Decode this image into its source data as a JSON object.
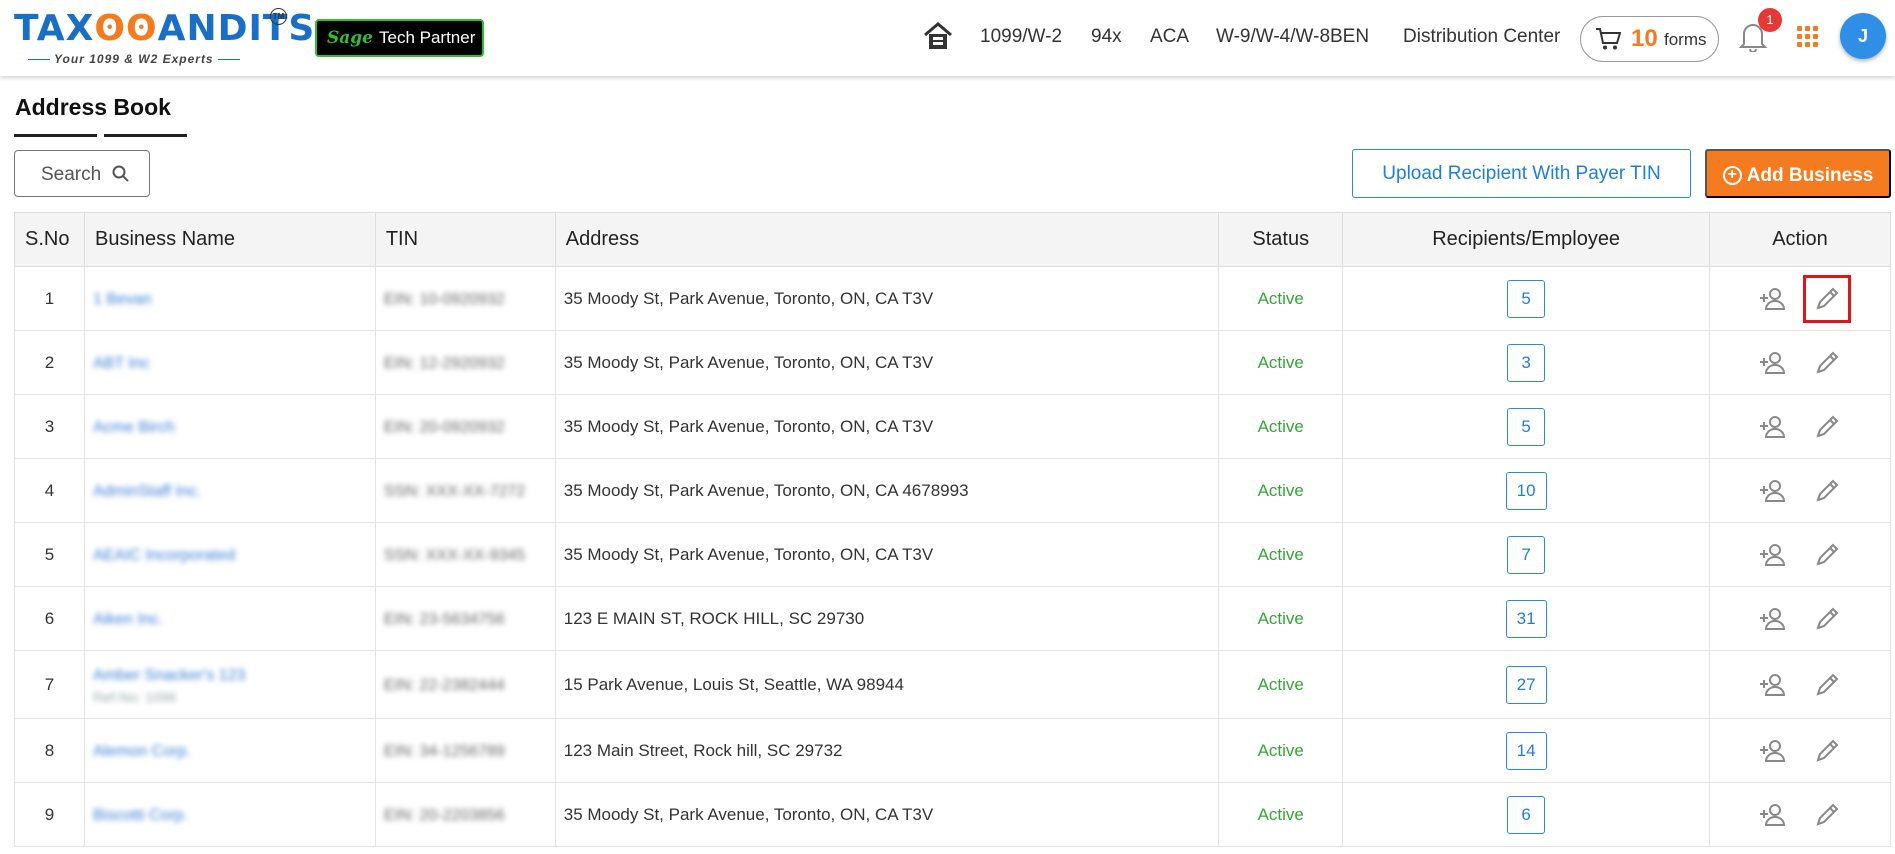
{
  "brand": {
    "name_part1": "TAX",
    "name_part2": "ANDITS",
    "tm": "TM",
    "tagline": "Your 1099 & W2 Experts",
    "partner_logo": "Sage",
    "partner_label": "Tech Partner"
  },
  "nav": {
    "home_icon": "home-icon",
    "items": [
      "1099/W-2",
      "94x",
      "ACA",
      "W-9/W-4/W-8BEN",
      "Distribution Center"
    ],
    "cart": {
      "count": "10",
      "label": "forms"
    },
    "notifications": "1",
    "avatar": "J"
  },
  "page": {
    "title": "Address Book"
  },
  "toolbar": {
    "search_label": "Search",
    "upload_label": "Upload Recipient With Payer TIN",
    "add_label": "Add Business",
    "add_symbol": "+"
  },
  "colors": {
    "accent": "#f47b20",
    "primary": "#1f7fd6",
    "active": "#35a635",
    "highlight": "#e0151b"
  },
  "table": {
    "headers": [
      "S.No",
      "Business Name",
      "TIN",
      "Address",
      "Status",
      "Recipients/Employee",
      "Action"
    ],
    "rows": [
      {
        "sno": "1",
        "name": "1 Bevan",
        "sub": "",
        "tin": "EIN: 10-0920932",
        "address": "35 Moody St, Park Avenue, Toronto, ON, CA T3V",
        "status": "Active",
        "count": "5"
      },
      {
        "sno": "2",
        "name": "ABT Inc",
        "sub": "",
        "tin": "EIN: 12-2920932",
        "address": "35 Moody St, Park Avenue, Toronto, ON, CA T3V",
        "status": "Active",
        "count": "3"
      },
      {
        "sno": "3",
        "name": "Acme Birch",
        "sub": "",
        "tin": "EIN: 20-0920932",
        "address": "35 Moody St, Park Avenue, Toronto, ON, CA T3V",
        "status": "Active",
        "count": "5"
      },
      {
        "sno": "4",
        "name": "AdminStaff Inc.",
        "sub": "",
        "tin": "SSN: XXX-XX-7272",
        "address": "35 Moody St, Park Avenue, Toronto, ON, CA 4678993",
        "status": "Active",
        "count": "10"
      },
      {
        "sno": "5",
        "name": "AEAIC Incorporated",
        "sub": "",
        "tin": "SSN: XXX-XX-9345",
        "address": "35 Moody St, Park Avenue, Toronto, ON, CA T3V",
        "status": "Active",
        "count": "7"
      },
      {
        "sno": "6",
        "name": "Aiken Inc.",
        "sub": "",
        "tin": "EIN: 23-5634756",
        "address": "123 E MAIN ST, ROCK HILL, SC 29730",
        "status": "Active",
        "count": "31"
      },
      {
        "sno": "7",
        "name": "Amber Snacker's 123",
        "sub": "Ref-No: 1096",
        "tin": "EIN: 22-2382444",
        "address": "15 Park Avenue, Louis St, Seattle, WA 98944",
        "status": "Active",
        "count": "27"
      },
      {
        "sno": "8",
        "name": "Alemon Corp.",
        "sub": "",
        "tin": "EIN: 34-1256789",
        "address": "123 Main Street, Rock hill, SC 29732",
        "status": "Active",
        "count": "14"
      },
      {
        "sno": "9",
        "name": "Biscotti Corp.",
        "sub": "",
        "tin": "EIN: 20-2203856",
        "address": "35 Moody St, Park Avenue, Toronto, ON, CA T3V",
        "status": "Active",
        "count": "6"
      }
    ]
  }
}
